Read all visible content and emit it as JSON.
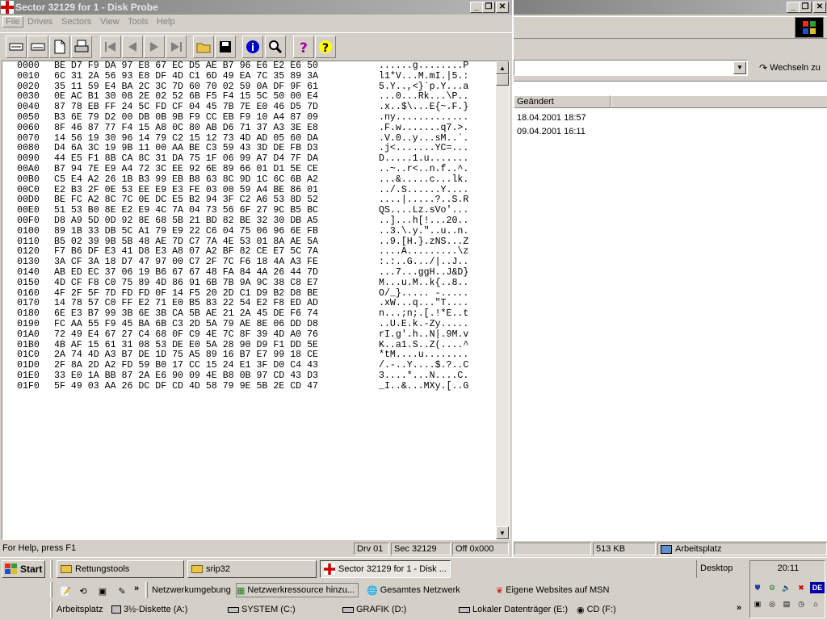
{
  "probe": {
    "title": "Sector 32129 for 1 - Disk Probe",
    "menu": [
      "File",
      "Drives",
      "Sectors",
      "View",
      "Tools",
      "Help"
    ],
    "toolbar_icons": [
      "read-sector-icon",
      "write-sector-icon",
      "new-icon",
      "print-icon",
      "first-sector-icon",
      "prev-sector-icon",
      "next-sector-icon",
      "last-sector-icon",
      "open-icon",
      "save-icon",
      "info-icon",
      "find-icon",
      "help-icon",
      "context-help-icon"
    ],
    "hex_lines": [
      {
        "off": "0000",
        "hex": "BE D7 F9 DA 97 E8 67 EC D5 AE B7 96 E6 E2 E6 50",
        "asc": "......g........P"
      },
      {
        "off": "0010",
        "hex": "6C 31 2A 56 93 E8 DF 4D C1 6D 49 EA 7C 35 89 3A",
        "asc": "l1*V...M.mI.|5.:"
      },
      {
        "off": "0020",
        "hex": "35 11 59 E4 BA 2C 3C 7D 60 70 02 59 0A DF 9F 61",
        "asc": "5.Y..,<}`p.Y...a"
      },
      {
        "off": "0030",
        "hex": "0E AC B1 30 08 2E 02 52 6B F5 F4 15 5C 50 00 E4",
        "asc": "...0...Rk...\\P.."
      },
      {
        "off": "0040",
        "hex": "87 78 EB FF 24 5C FD CF 04 45 7B 7E E0 46 D5 7D",
        "asc": ".x..$\\...E{~.F.}"
      },
      {
        "off": "0050",
        "hex": "B3 6E 79 D2 00 DB 0B 9B F9 CC EB F9 10 A4 87 09",
        "asc": ".ny............."
      },
      {
        "off": "0060",
        "hex": "8F 46 87 77 F4 15 A8 0C 80 AB D6 71 37 A3 3E E8",
        "asc": ".F.w.......q7.>."
      },
      {
        "off": "0070",
        "hex": "14 56 19 30 96 14 79 C2 15 12 73 4D AD 05 60 DA",
        "asc": ".V.0..y...sM..`."
      },
      {
        "off": "0080",
        "hex": "D4 6A 3C 19 9B 11 00 AA BE C3 59 43 3D DE FB D3",
        "asc": ".j<.......YC=..."
      },
      {
        "off": "0090",
        "hex": "44 E5 F1 8B CA 8C 31 DA 75 1F 06 99 A7 D4 7F DA",
        "asc": "D.....1.u......."
      },
      {
        "off": "00A0",
        "hex": "B7 94 7E E9 A4 72 3C EE 92 6E 89 66 01 D1 5E CE",
        "asc": "..~..r<..n.f..^."
      },
      {
        "off": "00B0",
        "hex": "C5 E4 A2 26 1B B3 99 EB B8 63 8C 9D 1C 6C 6B A2",
        "asc": "...&.....c...lk."
      },
      {
        "off": "00C0",
        "hex": "E2 B3 2F 0E 53 EE E9 E3 FE 03 00 59 A4 BE 86 01",
        "asc": "../.S......Y...."
      },
      {
        "off": "00D0",
        "hex": "BE FC A2 8C 7C 0E DC E5 B2 94 3F C2 A6 53 8D 52",
        "asc": "....|.....?..S.R"
      },
      {
        "off": "00E0",
        "hex": "51 53 B0 8E E2 E9 4C 7A 04 73 56 6F 27 9C B5 BC",
        "asc": "QS....Lz.sVo'..."
      },
      {
        "off": "00F0",
        "hex": "D8 A9 5D 0D 92 8E 68 5B 21 BD 82 BE 32 30 DB A5",
        "asc": "..]...h[!...20.."
      },
      {
        "off": "0100",
        "hex": "89 1B 33 DB 5C A1 79 E9 22 C6 04 75 06 96 6E FB",
        "asc": "..3.\\.y.\"..u..n."
      },
      {
        "off": "0110",
        "hex": "B5 02 39 9B 5B 48 AE 7D C7 7A 4E 53 01 8A AE 5A",
        "asc": "..9.[H.}.zNS...Z"
      },
      {
        "off": "0120",
        "hex": "F7 B6 DF E3 41 D8 E3 A8 07 A2 BF 82 CE E7 5C 7A",
        "asc": "....A.........\\z"
      },
      {
        "off": "0130",
        "hex": "3A CF 3A 18 D7 47 97 00 C7 2F 7C F6 18 4A A3 FE",
        "asc": ":.:..G.../|..J.."
      },
      {
        "off": "0140",
        "hex": "AB ED EC 37 06 19 B6 67 67 48 FA 84 4A 26 44 7D",
        "asc": "...7...ggH..J&D}"
      },
      {
        "off": "0150",
        "hex": "4D CF F8 C0 75 89 4D 86 91 6B 7B 9A 9C 38 C8 E7",
        "asc": "M...u.M..k{..8.."
      },
      {
        "off": "0160",
        "hex": "4F 2F 5F 7D FD FD 0F 14 F5 20 2D C1 D9 B2 D8 BE",
        "asc": "O/_}..... -....."
      },
      {
        "off": "0170",
        "hex": "14 78 57 C0 FF E2 71 E0 B5 83 22 54 E2 F8 ED AD",
        "asc": ".xW...q...\"T...."
      },
      {
        "off": "0180",
        "hex": "6E E3 B7 99 3B 6E 3B CA 5B AE 21 2A 45 DE F6 74",
        "asc": "n...;n;.[.!*E..t"
      },
      {
        "off": "0190",
        "hex": "FC AA 55 F9 45 BA 6B C3 2D 5A 79 AE 8E 06 DD D8",
        "asc": "..U.E.k.-Zy....."
      },
      {
        "off": "01A0",
        "hex": "72 49 E4 67 27 C4 68 0F C9 4E 7C 8F 39 4D A0 76",
        "asc": "rI.g'.h..N|.9M.v"
      },
      {
        "off": "01B0",
        "hex": "4B AF 15 61 31 08 53 DE E0 5A 28 90 D9 F1 DD 5E",
        "asc": "K..a1.S..Z(....^"
      },
      {
        "off": "01C0",
        "hex": "2A 74 4D A3 B7 DE 1D 75 A5 89 16 B7 E7 99 18 CE",
        "asc": "*tM....u........"
      },
      {
        "off": "01D0",
        "hex": "2F 8A 2D A2 FD 59 B0 17 CC 15 24 E1 3F D0 C4 43",
        "asc": "/.-..Y....$.?..C"
      },
      {
        "off": "01E0",
        "hex": "33 E0 1A BB 87 2A E6 90 09 4E B8 0B 97 CD 43 D3",
        "asc": "3....*...N....C."
      },
      {
        "off": "01F0",
        "hex": "5F 49 03 AA 26 DC DF CD 4D 58 79 9E 5B 2E CD 47",
        "asc": "_I..&...MXy.[..G"
      }
    ],
    "status": {
      "help": "For Help, press F1",
      "drive": "Drv  01",
      "sector": "Sec 32129",
      "offset": "Off 0x000"
    }
  },
  "explorer": {
    "go_label": "Wechseln zu",
    "column_header": "Geändert",
    "rows": [
      "18.04.2001 18:57",
      "09.04.2001 16:11"
    ],
    "status": {
      "size": "513 KB",
      "location": "Arbeitsplatz"
    }
  },
  "taskbar": {
    "start_label": "Start",
    "tasks": [
      "Rettungstools",
      "srip32",
      "Sector 32129 for 1 - Disk ..."
    ],
    "desktop_label": "Desktop",
    "clock": "20:11",
    "tray_lang": "DE",
    "links": [
      "Netzwerkumgebung",
      "Netzwerkressource hinzu...",
      "Gesamtes Netzwerk",
      "Eigene Websites auf MSN"
    ],
    "drives": [
      "Arbeitsplatz",
      "3½-Diskette (A:)",
      "SYSTEM (C:)",
      "GRAFIK (D:)",
      "Lokaler Datenträger (E:)",
      "CD (F:)"
    ],
    "colors": {
      "title_gradient_start": "#808080",
      "title_gradient_end": "#b5b5b5",
      "face": "#d4d0c8",
      "link_blue": "#0000c0"
    }
  }
}
